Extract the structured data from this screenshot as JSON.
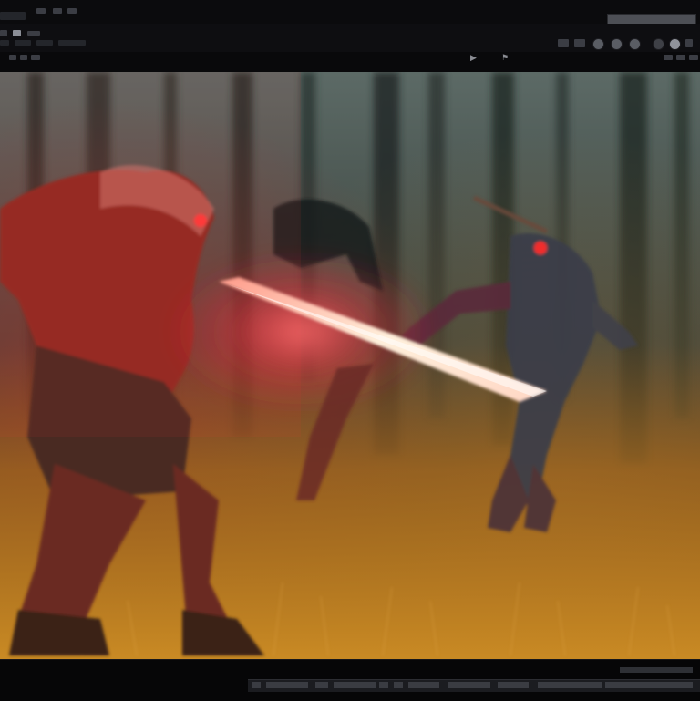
{
  "window": {
    "icons": {
      "app_icon": "app-icon",
      "play_icon": "play-icon",
      "flag_icon": "flag-icon"
    }
  },
  "toolbar": {
    "field_value": "",
    "buttons": [
      "tool-button",
      "tool-button",
      "tool-button",
      "tool-button",
      "tool-button",
      "tool-button",
      "tool-button"
    ]
  },
  "canvas": {
    "subject": "artwork",
    "palette": {
      "glow": "#ff3b3b",
      "blade": "#fff0dc",
      "forest": "#3f4f4a",
      "grass": "#b5741e"
    }
  },
  "statusbar": {
    "items": [
      "",
      "",
      "",
      ""
    ]
  }
}
